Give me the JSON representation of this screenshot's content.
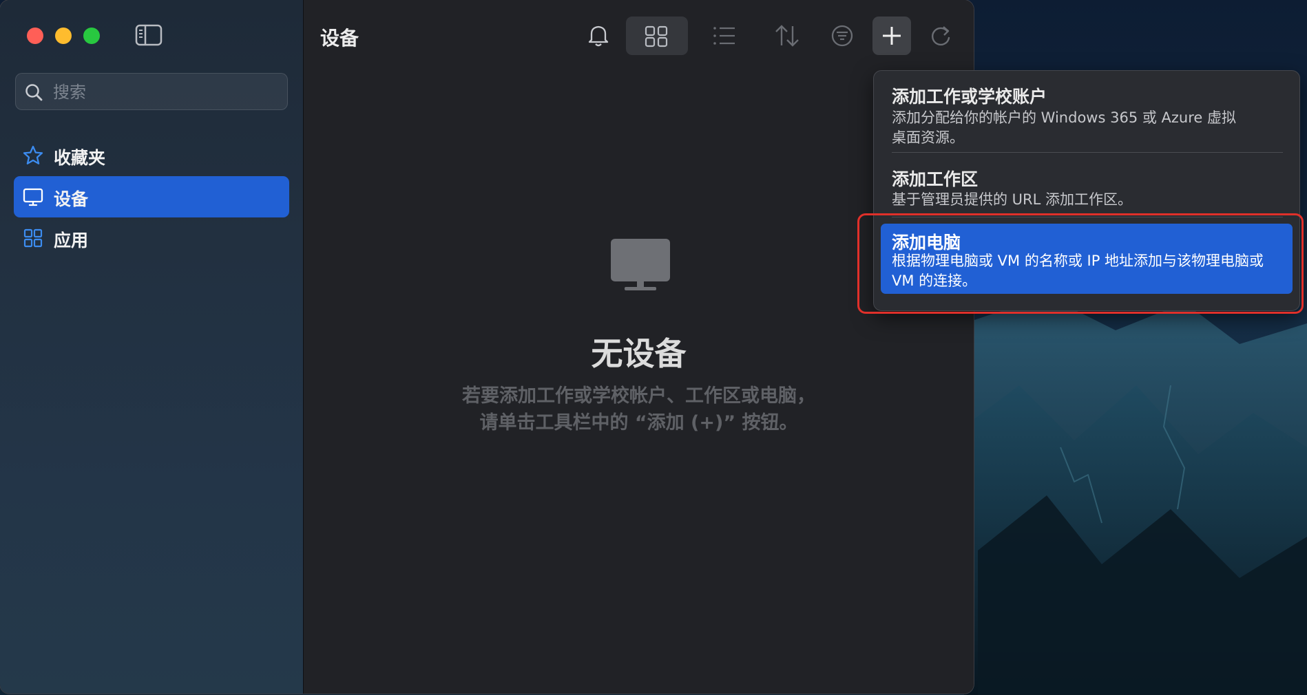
{
  "window": {
    "section_title": "设备"
  },
  "sidebar": {
    "search": {
      "placeholder": "搜索",
      "value": ""
    },
    "items": [
      {
        "label": "收藏夹",
        "icon": "star-icon",
        "active": false
      },
      {
        "label": "设备",
        "icon": "monitor-icon",
        "active": true
      },
      {
        "label": "应用",
        "icon": "apps-grid-icon",
        "active": false
      }
    ]
  },
  "toolbar": {
    "buttons": [
      "bell-icon",
      "grid-view-icon",
      "list-view-icon",
      "sort-icon",
      "filter-icon",
      "plus-icon",
      "refresh-icon"
    ],
    "selected_view": "grid-view-icon"
  },
  "main": {
    "empty_title": "无设备",
    "empty_desc_line1": "若要添加工作或学校帐户、工作区或电脑，",
    "empty_desc_line2": "请单击工具栏中的 “添加 (+)” 按钮。"
  },
  "add_menu": {
    "items": [
      {
        "title": "添加工作或学校账户",
        "desc_line1": "添加分配给你的帐户的 Windows 365 或 Azure 虚拟",
        "desc_line2": "桌面资源。"
      },
      {
        "title": "添加工作区",
        "desc_line1": "基于管理员提供的 URL 添加工作区。"
      },
      {
        "title": "添加电脑",
        "desc_line1": "根据物理电脑或 VM 的名称或 IP 地址添加与该物理电脑或",
        "desc_line2": "VM 的连接。",
        "highlighted": true
      }
    ]
  },
  "colors": {
    "accent": "#2160d4",
    "annotation": "#e0302a",
    "traffic_red": "#ff5f57",
    "traffic_yellow": "#febc2e",
    "traffic_green": "#28c840"
  }
}
